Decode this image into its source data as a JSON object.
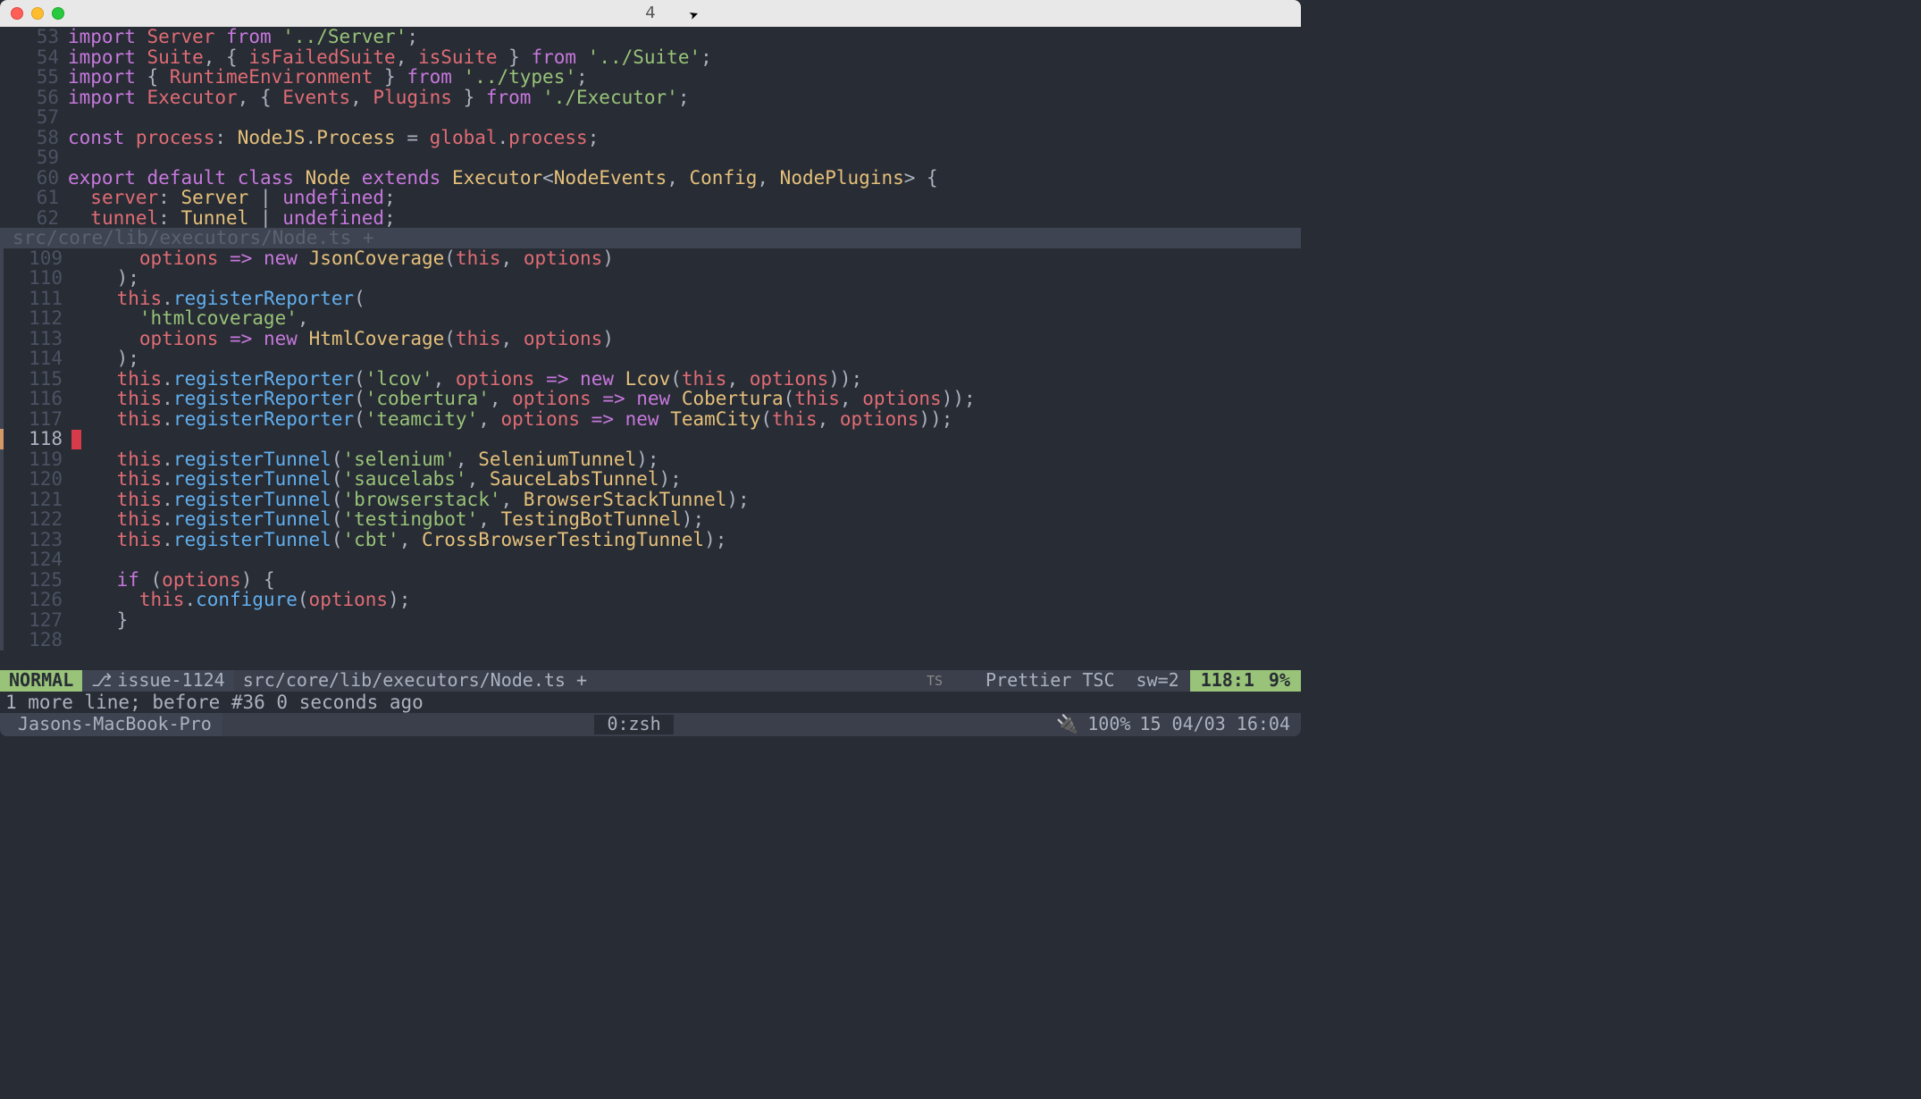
{
  "window": {
    "title": "4"
  },
  "path_bar": "src/core/lib/executors/Node.ts +",
  "lines_top": [
    {
      "n": 53,
      "tokens": [
        [
          "kw",
          "import"
        ],
        [
          "punc",
          " "
        ],
        [
          "id",
          "Server"
        ],
        [
          "punc",
          " "
        ],
        [
          "kw",
          "from"
        ],
        [
          "punc",
          " "
        ],
        [
          "str",
          "'../Server'"
        ],
        [
          "punc",
          ";"
        ]
      ]
    },
    {
      "n": 54,
      "tokens": [
        [
          "kw",
          "import"
        ],
        [
          "punc",
          " "
        ],
        [
          "id",
          "Suite"
        ],
        [
          "punc",
          ", { "
        ],
        [
          "id",
          "isFailedSuite"
        ],
        [
          "punc",
          ", "
        ],
        [
          "id",
          "isSuite"
        ],
        [
          "punc",
          " } "
        ],
        [
          "kw",
          "from"
        ],
        [
          "punc",
          " "
        ],
        [
          "str",
          "'../Suite'"
        ],
        [
          "punc",
          ";"
        ]
      ]
    },
    {
      "n": 55,
      "tokens": [
        [
          "kw",
          "import"
        ],
        [
          "punc",
          " { "
        ],
        [
          "id",
          "RuntimeEnvironment"
        ],
        [
          "punc",
          " } "
        ],
        [
          "kw",
          "from"
        ],
        [
          "punc",
          " "
        ],
        [
          "str",
          "'../types'"
        ],
        [
          "punc",
          ";"
        ]
      ]
    },
    {
      "n": 56,
      "tokens": [
        [
          "kw",
          "import"
        ],
        [
          "punc",
          " "
        ],
        [
          "id",
          "Executor"
        ],
        [
          "punc",
          ", { "
        ],
        [
          "id",
          "Events"
        ],
        [
          "punc",
          ", "
        ],
        [
          "id",
          "Plugins"
        ],
        [
          "punc",
          " } "
        ],
        [
          "kw",
          "from"
        ],
        [
          "punc",
          " "
        ],
        [
          "str",
          "'./Executor'"
        ],
        [
          "punc",
          ";"
        ]
      ]
    },
    {
      "n": 57,
      "tokens": []
    },
    {
      "n": 58,
      "tokens": [
        [
          "kw",
          "const"
        ],
        [
          "punc",
          " "
        ],
        [
          "id",
          "process"
        ],
        [
          "punc",
          ": "
        ],
        [
          "type",
          "NodeJS"
        ],
        [
          "punc",
          "."
        ],
        [
          "type",
          "Process"
        ],
        [
          "punc",
          " = "
        ],
        [
          "id",
          "global"
        ],
        [
          "punc",
          "."
        ],
        [
          "id",
          "process"
        ],
        [
          "punc",
          ";"
        ]
      ]
    },
    {
      "n": 59,
      "tokens": []
    },
    {
      "n": 60,
      "tokens": [
        [
          "kw",
          "export"
        ],
        [
          "punc",
          " "
        ],
        [
          "kw",
          "default"
        ],
        [
          "punc",
          " "
        ],
        [
          "kw",
          "class"
        ],
        [
          "punc",
          " "
        ],
        [
          "cls",
          "Node"
        ],
        [
          "punc",
          " "
        ],
        [
          "kw",
          "extends"
        ],
        [
          "punc",
          " "
        ],
        [
          "cls",
          "Executor"
        ],
        [
          "punc",
          "<"
        ],
        [
          "type",
          "NodeEvents"
        ],
        [
          "punc",
          ", "
        ],
        [
          "type",
          "Config"
        ],
        [
          "punc",
          ", "
        ],
        [
          "type",
          "NodePlugins"
        ],
        [
          "punc",
          "> {"
        ]
      ]
    },
    {
      "n": 61,
      "tokens": [
        [
          "punc",
          "  "
        ],
        [
          "id",
          "server"
        ],
        [
          "punc",
          ": "
        ],
        [
          "type",
          "Server"
        ],
        [
          "punc",
          " | "
        ],
        [
          "kw",
          "undefined"
        ],
        [
          "punc",
          ";"
        ]
      ]
    },
    {
      "n": 62,
      "tokens": [
        [
          "punc",
          "  "
        ],
        [
          "id",
          "tunnel"
        ],
        [
          "punc",
          ": "
        ],
        [
          "type",
          "Tunnel"
        ],
        [
          "punc",
          " | "
        ],
        [
          "kw",
          "undefined"
        ],
        [
          "punc",
          ";"
        ]
      ]
    }
  ],
  "lines_bot": [
    {
      "n": 109,
      "tokens": [
        [
          "punc",
          "      "
        ],
        [
          "id",
          "options"
        ],
        [
          "punc",
          " "
        ],
        [
          "kw",
          "=>"
        ],
        [
          "punc",
          " "
        ],
        [
          "kw",
          "new"
        ],
        [
          "punc",
          " "
        ],
        [
          "cls",
          "JsonCoverage"
        ],
        [
          "punc",
          "("
        ],
        [
          "this",
          "this"
        ],
        [
          "punc",
          ", "
        ],
        [
          "id",
          "options"
        ],
        [
          "punc",
          ")"
        ]
      ]
    },
    {
      "n": 110,
      "tokens": [
        [
          "punc",
          "    );"
        ]
      ]
    },
    {
      "n": 111,
      "tokens": [
        [
          "punc",
          "    "
        ],
        [
          "this",
          "this"
        ],
        [
          "punc",
          "."
        ],
        [
          "fn",
          "registerReporter"
        ],
        [
          "punc",
          "("
        ]
      ]
    },
    {
      "n": 112,
      "tokens": [
        [
          "punc",
          "      "
        ],
        [
          "str",
          "'htmlcoverage'"
        ],
        [
          "punc",
          ","
        ]
      ]
    },
    {
      "n": 113,
      "tokens": [
        [
          "punc",
          "      "
        ],
        [
          "id",
          "options"
        ],
        [
          "punc",
          " "
        ],
        [
          "kw",
          "=>"
        ],
        [
          "punc",
          " "
        ],
        [
          "kw",
          "new"
        ],
        [
          "punc",
          " "
        ],
        [
          "cls",
          "HtmlCoverage"
        ],
        [
          "punc",
          "("
        ],
        [
          "this",
          "this"
        ],
        [
          "punc",
          ", "
        ],
        [
          "id",
          "options"
        ],
        [
          "punc",
          ")"
        ]
      ]
    },
    {
      "n": 114,
      "tokens": [
        [
          "punc",
          "    );"
        ]
      ]
    },
    {
      "n": 115,
      "tokens": [
        [
          "punc",
          "    "
        ],
        [
          "this",
          "this"
        ],
        [
          "punc",
          "."
        ],
        [
          "fn",
          "registerReporter"
        ],
        [
          "punc",
          "("
        ],
        [
          "str",
          "'lcov'"
        ],
        [
          "punc",
          ", "
        ],
        [
          "id",
          "options"
        ],
        [
          "punc",
          " "
        ],
        [
          "kw",
          "=>"
        ],
        [
          "punc",
          " "
        ],
        [
          "kw",
          "new"
        ],
        [
          "punc",
          " "
        ],
        [
          "cls",
          "Lcov"
        ],
        [
          "punc",
          "("
        ],
        [
          "this",
          "this"
        ],
        [
          "punc",
          ", "
        ],
        [
          "id",
          "options"
        ],
        [
          "punc",
          "));"
        ]
      ]
    },
    {
      "n": 116,
      "tokens": [
        [
          "punc",
          "    "
        ],
        [
          "this",
          "this"
        ],
        [
          "punc",
          "."
        ],
        [
          "fn",
          "registerReporter"
        ],
        [
          "punc",
          "("
        ],
        [
          "str",
          "'cobertura'"
        ],
        [
          "punc",
          ", "
        ],
        [
          "id",
          "options"
        ],
        [
          "punc",
          " "
        ],
        [
          "kw",
          "=>"
        ],
        [
          "punc",
          " "
        ],
        [
          "kw",
          "new"
        ],
        [
          "punc",
          " "
        ],
        [
          "cls",
          "Cobertura"
        ],
        [
          "punc",
          "("
        ],
        [
          "this",
          "this"
        ],
        [
          "punc",
          ", "
        ],
        [
          "id",
          "options"
        ],
        [
          "punc",
          "));"
        ]
      ]
    },
    {
      "n": 117,
      "tokens": [
        [
          "punc",
          "    "
        ],
        [
          "this",
          "this"
        ],
        [
          "punc",
          "."
        ],
        [
          "fn",
          "registerReporter"
        ],
        [
          "punc",
          "("
        ],
        [
          "str",
          "'teamcity'"
        ],
        [
          "punc",
          ", "
        ],
        [
          "id",
          "options"
        ],
        [
          "punc",
          " "
        ],
        [
          "kw",
          "=>"
        ],
        [
          "punc",
          " "
        ],
        [
          "kw",
          "new"
        ],
        [
          "punc",
          " "
        ],
        [
          "cls",
          "TeamCity"
        ],
        [
          "punc",
          "("
        ],
        [
          "this",
          "this"
        ],
        [
          "punc",
          ", "
        ],
        [
          "id",
          "options"
        ],
        [
          "punc",
          "));"
        ]
      ]
    },
    {
      "n": 118,
      "cursor": true,
      "tokens": []
    },
    {
      "n": 119,
      "tokens": [
        [
          "punc",
          "    "
        ],
        [
          "this",
          "this"
        ],
        [
          "punc",
          "."
        ],
        [
          "fn",
          "registerTunnel"
        ],
        [
          "punc",
          "("
        ],
        [
          "str",
          "'selenium'"
        ],
        [
          "punc",
          ", "
        ],
        [
          "cls",
          "SeleniumTunnel"
        ],
        [
          "punc",
          ");"
        ]
      ]
    },
    {
      "n": 120,
      "tokens": [
        [
          "punc",
          "    "
        ],
        [
          "this",
          "this"
        ],
        [
          "punc",
          "."
        ],
        [
          "fn",
          "registerTunnel"
        ],
        [
          "punc",
          "("
        ],
        [
          "str",
          "'saucelabs'"
        ],
        [
          "punc",
          ", "
        ],
        [
          "cls",
          "SauceLabsTunnel"
        ],
        [
          "punc",
          ");"
        ]
      ]
    },
    {
      "n": 121,
      "tokens": [
        [
          "punc",
          "    "
        ],
        [
          "this",
          "this"
        ],
        [
          "punc",
          "."
        ],
        [
          "fn",
          "registerTunnel"
        ],
        [
          "punc",
          "("
        ],
        [
          "str",
          "'browserstack'"
        ],
        [
          "punc",
          ", "
        ],
        [
          "cls",
          "BrowserStackTunnel"
        ],
        [
          "punc",
          ");"
        ]
      ]
    },
    {
      "n": 122,
      "tokens": [
        [
          "punc",
          "    "
        ],
        [
          "this",
          "this"
        ],
        [
          "punc",
          "."
        ],
        [
          "fn",
          "registerTunnel"
        ],
        [
          "punc",
          "("
        ],
        [
          "str",
          "'testingbot'"
        ],
        [
          "punc",
          ", "
        ],
        [
          "cls",
          "TestingBotTunnel"
        ],
        [
          "punc",
          ");"
        ]
      ]
    },
    {
      "n": 123,
      "tokens": [
        [
          "punc",
          "    "
        ],
        [
          "this",
          "this"
        ],
        [
          "punc",
          "."
        ],
        [
          "fn",
          "registerTunnel"
        ],
        [
          "punc",
          "("
        ],
        [
          "str",
          "'cbt'"
        ],
        [
          "punc",
          ", "
        ],
        [
          "cls",
          "CrossBrowserTestingTunnel"
        ],
        [
          "punc",
          ");"
        ]
      ]
    },
    {
      "n": 124,
      "tokens": []
    },
    {
      "n": 125,
      "tokens": [
        [
          "punc",
          "    "
        ],
        [
          "kw",
          "if"
        ],
        [
          "punc",
          " ("
        ],
        [
          "id",
          "options"
        ],
        [
          "punc",
          ") {"
        ]
      ]
    },
    {
      "n": 126,
      "tokens": [
        [
          "punc",
          "      "
        ],
        [
          "this",
          "this"
        ],
        [
          "punc",
          "."
        ],
        [
          "fn",
          "configure"
        ],
        [
          "punc",
          "("
        ],
        [
          "id",
          "options"
        ],
        [
          "punc",
          ");"
        ]
      ]
    },
    {
      "n": 127,
      "tokens": [
        [
          "punc",
          "    }"
        ]
      ]
    },
    {
      "n": 128,
      "tokens": []
    }
  ],
  "status": {
    "mode": "NORMAL",
    "branch": "issue-1124",
    "file": "src/core/lib/executors/Node.ts +",
    "filetype": "TS",
    "tools": "Prettier TSC",
    "sw": "sw=2",
    "pos": "118:1",
    "pct": "9%"
  },
  "cmdline": "1 more line; before #36  0 seconds ago",
  "tmux": {
    "host": "Jasons-MacBook-Pro",
    "window": "0:zsh",
    "battery": "100%",
    "date": "15 04/03 16:04"
  }
}
